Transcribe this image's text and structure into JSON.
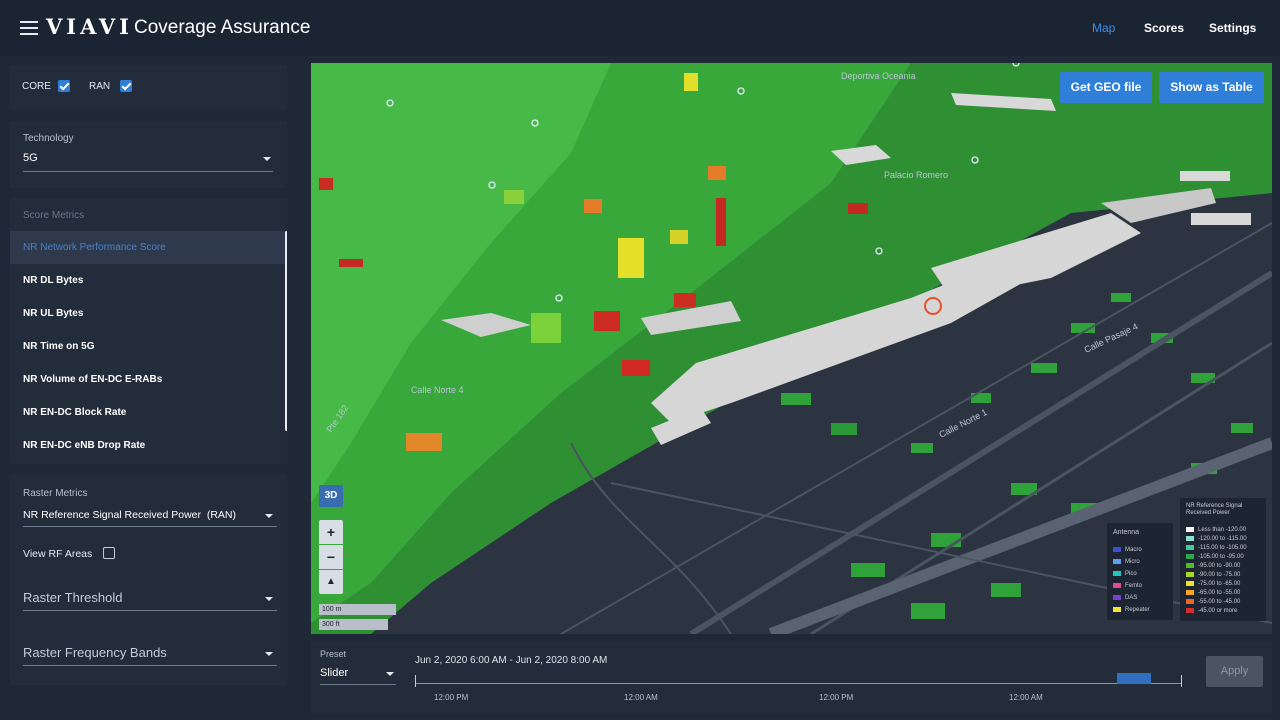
{
  "header": {
    "logo_text": "VIAVI",
    "title": "Coverage Assurance",
    "nav": [
      "Map",
      "Scores",
      "Settings"
    ],
    "active_nav": "Map",
    "accent_color": "#2f7fd8"
  },
  "filters": {
    "core_label": "CORE",
    "core_checked": true,
    "ran_label": "RAN",
    "ran_checked": true
  },
  "technology": {
    "label": "Technology",
    "value": "5G"
  },
  "score_metrics": {
    "label": "Score Metrics",
    "items": [
      "NR Network Performance Score",
      "NR DL Bytes",
      "NR UL Bytes",
      "NR Time on 5G",
      "NR Volume of EN-DC E-RABs",
      "NR EN-DC Block Rate",
      "NR EN-DC eNB Drop Rate"
    ],
    "selected": "NR Network Performance Score"
  },
  "raster": {
    "label": "Raster Metrics",
    "value": "NR Reference Signal Received Power  (RAN)",
    "view_rf_label": "View RF Areas",
    "view_rf_checked": false,
    "threshold_placeholder": "Raster Threshold",
    "bands_placeholder": "Raster Frequency Bands"
  },
  "map": {
    "get_geo_label": "Get GEO file",
    "show_table_label": "Show as Table",
    "mode_3d_label": "3D",
    "zoom_in": "+",
    "zoom_out": "−",
    "scale_m": "100 m",
    "scale_ft": "300 ft",
    "street_labels": [
      "Deportiva Oceania",
      "Palacio Romero",
      "Calle Pasaje 4",
      "Calle Norte 1",
      "Calle Norte 4",
      "Pte 182"
    ],
    "antenna_legend": {
      "title": "Antenna",
      "items": [
        {
          "name": "Macro",
          "color": "#3d4fd6"
        },
        {
          "name": "Micro",
          "color": "#5fa0e8"
        },
        {
          "name": "Pico",
          "color": "#27c4c4"
        },
        {
          "name": "Femto",
          "color": "#e84a8a"
        },
        {
          "name": "DAS",
          "color": "#7b3fd0"
        },
        {
          "name": "Repeater",
          "color": "#f2e23a"
        }
      ]
    },
    "rsrp_legend": {
      "title": "NR Reference Signal Received Power",
      "items": [
        {
          "name": "Less than -120.00",
          "color": "#f4f4f4"
        },
        {
          "name": "-120.00 to -115.00",
          "color": "#8ee0d2"
        },
        {
          "name": "-115.00 to -105.00",
          "color": "#46c79b"
        },
        {
          "name": "-105.00 to -95.00",
          "color": "#2da84a"
        },
        {
          "name": "-95.00 to -90.00",
          "color": "#57b82e"
        },
        {
          "name": "-90.00 to -75.00",
          "color": "#a8d52c"
        },
        {
          "name": "-75.00 to -65.00",
          "color": "#f0de2c"
        },
        {
          "name": "-65.00 to -55.00",
          "color": "#f5a623"
        },
        {
          "name": "-55.00 to -45.00",
          "color": "#e8672a"
        },
        {
          "name": "-45.00 or more",
          "color": "#d92b2b"
        }
      ]
    }
  },
  "timeline": {
    "preset_label": "Preset",
    "preset_value": "Slider",
    "range_text": "Jun 2, 2020 6:00 AM - Jun 2, 2020 8:00 AM",
    "ticks": [
      "12:00 PM",
      "12:00 AM",
      "12:00 PM",
      "12:00 AM"
    ],
    "apply_label": "Apply"
  }
}
